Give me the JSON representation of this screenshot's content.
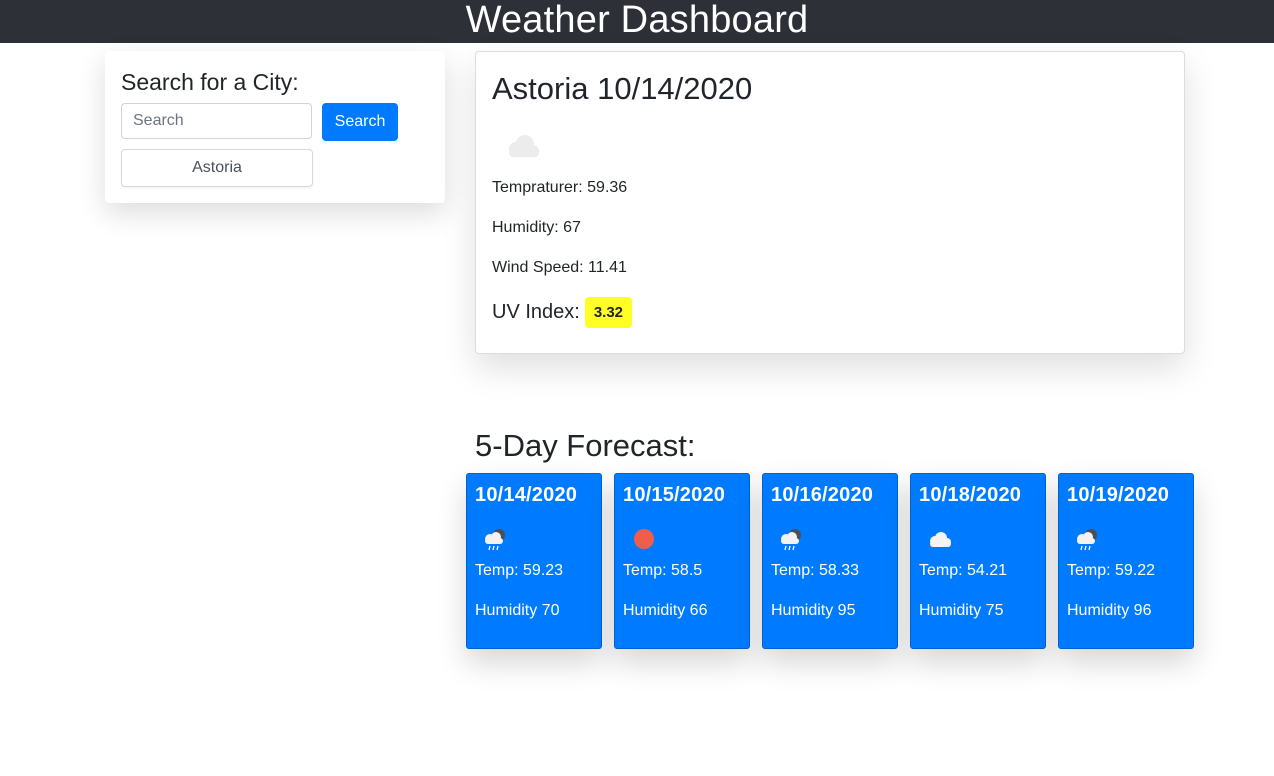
{
  "header": {
    "title": "Weather Dashboard"
  },
  "search": {
    "heading": "Search for a City:",
    "placeholder": "Search",
    "value": "",
    "button_label": "Search",
    "history": [
      "Astoria"
    ]
  },
  "current": {
    "title": "Astoria 10/14/2020",
    "icon": "cloud-icon",
    "temperature_text": "Tempraturer: 59.36",
    "humidity_text": "Humidity: 67",
    "wind_text": "Wind Speed: 11.41",
    "uv_label": "UV Index:",
    "uv_value": "3.32",
    "uv_color": "#ffff24"
  },
  "forecast": {
    "heading": "5-Day Forecast:",
    "card_color": "#007bff",
    "days": [
      {
        "date": "10/14/2020",
        "icon": "rain-cloud-icon",
        "temp": "Temp: 59.23",
        "humidity": "Humidity 70"
      },
      {
        "date": "10/15/2020",
        "icon": "sun-icon",
        "temp": "Temp: 58.5",
        "humidity": "Humidity 66"
      },
      {
        "date": "10/16/2020",
        "icon": "rain-cloud-icon",
        "temp": "Temp: 58.33",
        "humidity": "Humidity 95"
      },
      {
        "date": "10/18/2020",
        "icon": "cloud-icon",
        "temp": "Temp: 54.21",
        "humidity": "Humidity 75"
      },
      {
        "date": "10/19/2020",
        "icon": "rain-cloud-icon",
        "temp": "Temp: 59.22",
        "humidity": "Humidity 96"
      }
    ]
  }
}
